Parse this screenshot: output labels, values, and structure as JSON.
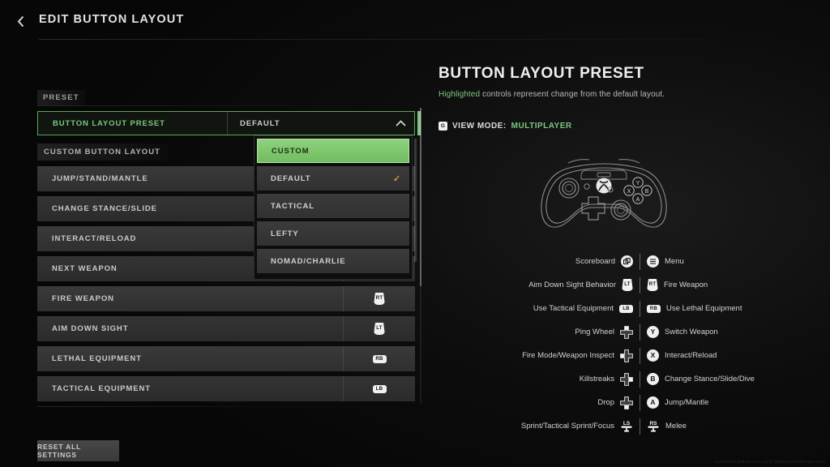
{
  "header": {
    "title": "EDIT BUTTON LAYOUT",
    "back_icon": "chevron-left-icon"
  },
  "left": {
    "section_label": "PRESET",
    "preset_row": {
      "label": "BUTTON LAYOUT PRESET",
      "value": "DEFAULT",
      "chevron": "chevron-up-icon"
    },
    "dropdown": {
      "options": [
        {
          "label": "CUSTOM",
          "state": "highlighted"
        },
        {
          "label": "DEFAULT",
          "state": "checked"
        },
        {
          "label": "TACTICAL",
          "state": "normal"
        },
        {
          "label": "LEFTY",
          "state": "normal"
        },
        {
          "label": "NOMAD/CHARLIE",
          "state": "normal"
        }
      ],
      "check_glyph": "✓"
    },
    "subsection_label": "CUSTOM BUTTON LAYOUT",
    "items": [
      {
        "label": "JUMP/STAND/MANTLE",
        "badge": "",
        "badge_type": "none"
      },
      {
        "label": "CHANGE STANCE/SLIDE",
        "badge": "",
        "badge_type": "none"
      },
      {
        "label": "INTERACT/RELOAD",
        "badge": "",
        "badge_type": "none"
      },
      {
        "label": "NEXT WEAPON",
        "badge": "",
        "badge_type": "none"
      },
      {
        "label": "FIRE WEAPON",
        "badge": "RT",
        "badge_type": "trigger"
      },
      {
        "label": "AIM DOWN SIGHT",
        "badge": "LT",
        "badge_type": "trigger"
      },
      {
        "label": "LETHAL EQUIPMENT",
        "badge": "RB",
        "badge_type": "bumper"
      },
      {
        "label": "TACTICAL EQUIPMENT",
        "badge": "LB",
        "badge_type": "bumper"
      }
    ],
    "reset_button": "RESET ALL SETTINGS"
  },
  "right": {
    "title": "BUTTON LAYOUT PRESET",
    "subtitle_highlight": "Highlighted",
    "subtitle_rest": " controls represent change from the default layout.",
    "view_mode": {
      "key_badge": "G",
      "label": "VIEW MODE:",
      "value": "MULTIPLAYER"
    },
    "controller_icon": "xbox-controller-diagram",
    "legend": [
      {
        "left_label": "Scoreboard",
        "left_icon": "view-button-icon",
        "left_icon_kind": "view",
        "right_icon": "menu-button-icon",
        "right_icon_kind": "menu",
        "right_label": "Menu"
      },
      {
        "left_label": "Aim Down Sight Behavior",
        "left_icon": "LT",
        "left_icon_kind": "trigger",
        "right_icon": "RT",
        "right_icon_kind": "trigger",
        "right_label": "Fire Weapon"
      },
      {
        "left_label": "Use Tactical Equipment",
        "left_icon": "LB",
        "left_icon_kind": "bumper",
        "right_icon": "RB",
        "right_icon_kind": "bumper",
        "right_label": "Use Lethal Equipment"
      },
      {
        "left_label": "Ping Wheel",
        "left_icon": "dpad-up-icon",
        "left_icon_kind": "dpad-up",
        "right_icon": "Y",
        "right_icon_kind": "face",
        "right_label": "Switch Weapon"
      },
      {
        "left_label": "Fire Mode/Weapon Inspect",
        "left_icon": "dpad-left-icon",
        "left_icon_kind": "dpad-left",
        "right_icon": "X",
        "right_icon_kind": "face",
        "right_label": "Interact/Reload"
      },
      {
        "left_label": "Killstreaks",
        "left_icon": "dpad-right-icon",
        "left_icon_kind": "dpad-right",
        "right_icon": "B",
        "right_icon_kind": "face",
        "right_label": "Change Stance/Slide/Dive"
      },
      {
        "left_label": "Drop",
        "left_icon": "dpad-down-icon",
        "left_icon_kind": "dpad-down",
        "right_icon": "A",
        "right_icon_kind": "face",
        "right_label": "Jump/Mantle"
      },
      {
        "left_label": "Sprint/Tactical Sprint/Focus",
        "left_icon": "LS",
        "left_icon_kind": "stick",
        "right_icon": "RS",
        "right_icon_kind": "stick",
        "right_label": "Melee"
      }
    ]
  },
  "build_string": "9.8.13041923 [255:101:1614+11] Tri: [15003]1169252578 pt.0.steam"
}
